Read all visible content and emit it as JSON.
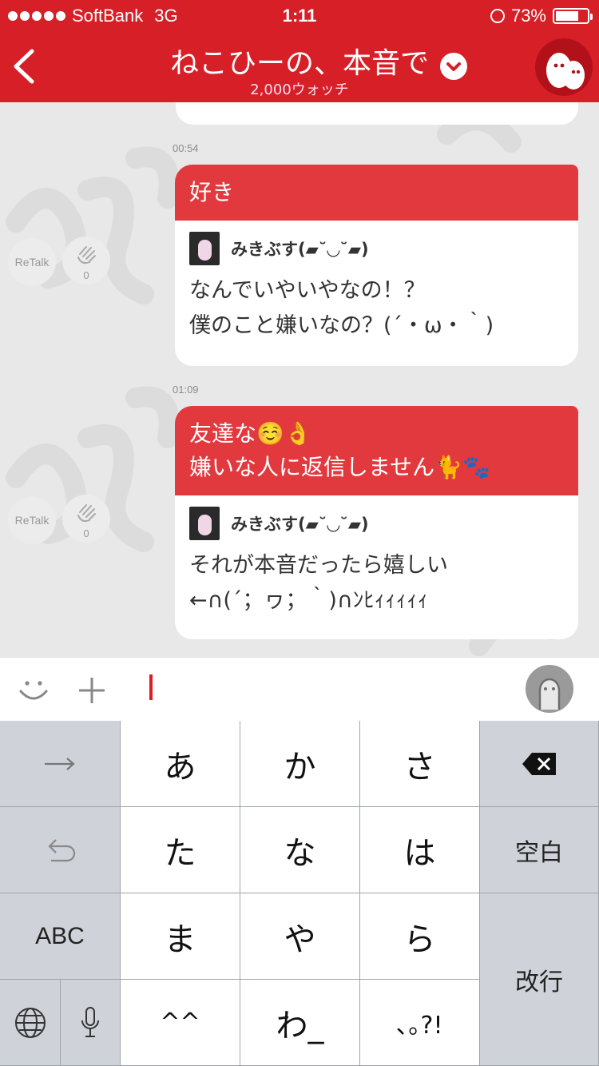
{
  "status": {
    "carrier": "SoftBank",
    "network": "3G",
    "time": "1:11",
    "battery_text": "73%",
    "battery_level": 0.73
  },
  "header": {
    "title": "ねこひーの、本音で",
    "subtitle": "2,000ウォッチ"
  },
  "messages": [
    {
      "time": "00:54",
      "text": "好き",
      "quote_author": "みきぶす(▰˘◡˘▰)",
      "quote_text_1": "なんでいやいやなの！？",
      "quote_text_2": "僕のこと嫌いなの？(´・ω・｀)",
      "retalk": "ReTalk",
      "clap_count": "0"
    },
    {
      "time": "01:09",
      "text_1": "友達な☺️👌",
      "text_2": "嫌いな人に返信しません🐈🐾",
      "quote_author": "みきぶす(▰˘◡˘▰)",
      "quote_text_1": "それが本音だったら嬉しい",
      "quote_text_2": "←∩(´；ヮ；｀)∩ﾝﾋｨｨｨｨｨ",
      "retalk": "ReTalk",
      "clap_count": "0"
    }
  ],
  "keyboard": {
    "row1": [
      "あ",
      "か",
      "さ"
    ],
    "row2": [
      "た",
      "な",
      "は"
    ],
    "row3": [
      "ま",
      "や",
      "ら"
    ],
    "row4": [
      "^^",
      "わ_",
      "､｡?!"
    ],
    "space": "空白",
    "abc": "ABC",
    "return": "改行"
  },
  "colors": {
    "brand": "#d71f27",
    "bubble": "#e1393e"
  }
}
